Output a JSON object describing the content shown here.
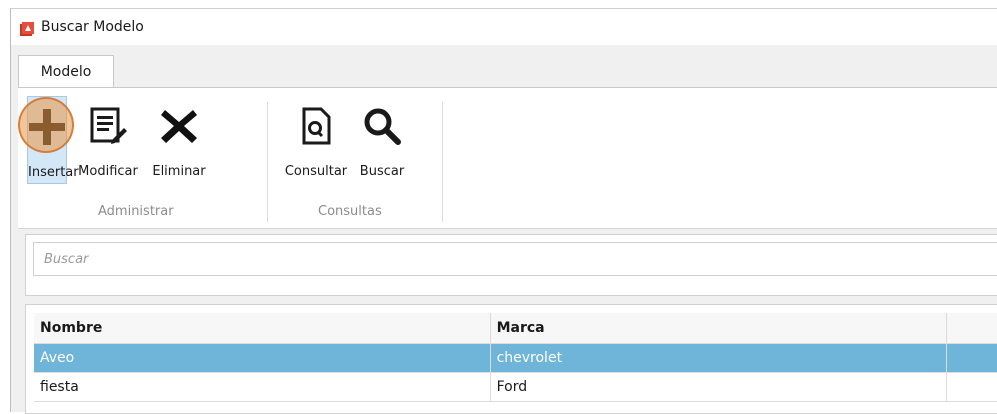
{
  "window": {
    "title": "Buscar Modelo",
    "icon": "app-document-icon",
    "accent": "#c0392b"
  },
  "tabs": [
    {
      "label": "Modelo",
      "active": true
    }
  ],
  "ribbon": {
    "groups": [
      {
        "label": "Administrar",
        "buttons": [
          {
            "label": "Insertar",
            "icon": "plus-icon",
            "selected": true
          },
          {
            "label": "Modificar",
            "icon": "edit-document-icon"
          },
          {
            "label": "Eliminar",
            "icon": "x-delete-icon"
          }
        ]
      },
      {
        "label": "Consultas",
        "buttons": [
          {
            "label": "Consultar",
            "icon": "document-search-icon"
          },
          {
            "label": "Buscar",
            "icon": "magnifier-icon"
          }
        ]
      }
    ]
  },
  "search": {
    "placeholder": "Buscar",
    "value": ""
  },
  "grid": {
    "columns": [
      "Nombre",
      "Marca",
      ""
    ],
    "rows": [
      {
        "nombre": "Aveo",
        "marca": "chevrolet",
        "selected": true
      },
      {
        "nombre": "fiesta",
        "marca": "Ford",
        "selected": false
      }
    ],
    "selection_color": "#6fb5d9"
  }
}
